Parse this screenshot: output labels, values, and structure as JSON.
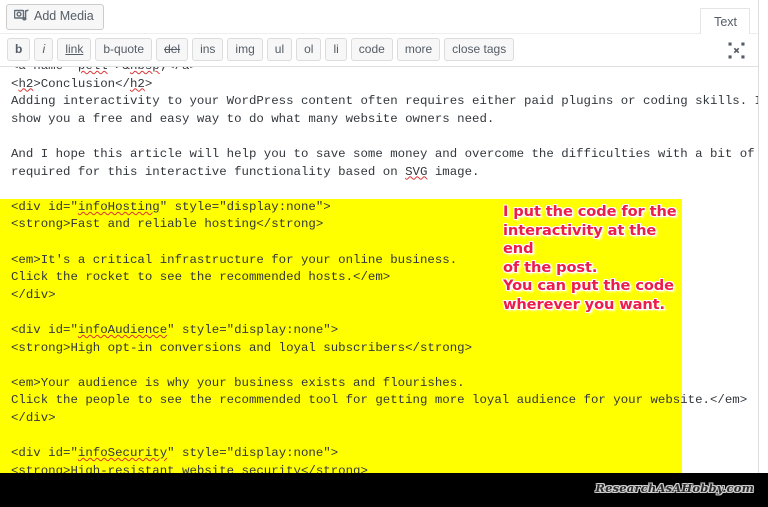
{
  "window": {
    "app": "WordPress Post Editor",
    "editor_mode": "Text"
  },
  "media_row": {
    "add_media_label": "Add Media",
    "add_media_icon": "media-icon"
  },
  "tabs": [
    {
      "label": "Text",
      "active": true
    }
  ],
  "quicktags": {
    "buttons": [
      {
        "label": "b",
        "name": "qt-bold"
      },
      {
        "label": "i",
        "name": "qt-italic"
      },
      {
        "label": "link",
        "name": "qt-link"
      },
      {
        "label": "b-quote",
        "name": "qt-blockquote"
      },
      {
        "label": "del",
        "name": "qt-del"
      },
      {
        "label": "ins",
        "name": "qt-ins"
      },
      {
        "label": "img",
        "name": "qt-img"
      },
      {
        "label": "ul",
        "name": "qt-ul"
      },
      {
        "label": "ol",
        "name": "qt-ol"
      },
      {
        "label": "li",
        "name": "qt-li"
      },
      {
        "label": "code",
        "name": "qt-code"
      },
      {
        "label": "more",
        "name": "qt-more"
      },
      {
        "label": "close tags",
        "name": "qt-close-tags"
      }
    ],
    "fullscreen_icon": "distraction-free-writing-icon"
  },
  "code": {
    "lines": [
      {
        "text": "<a name=\"pell\">&nbsp;</a>",
        "highlight": false
      },
      {
        "text": "<h2>Conclusion</h2>",
        "highlight": false
      },
      {
        "text": "Adding interactivity to your WordPress content often requires either paid plugins or coding skills. I wanted to",
        "highlight": false
      },
      {
        "text": "show you a free and easy way to do what many website owners need.",
        "highlight": false
      },
      {
        "text": "",
        "highlight": false
      },
      {
        "text": "And I hope this article will help you to save some money and overcome the difficulties with a bit of coding that is",
        "highlight": false
      },
      {
        "text": "required for this interactive functionality based on SVG image.",
        "highlight": false
      },
      {
        "text": "",
        "highlight": false
      },
      {
        "text": "<div id=\"infoHosting\" style=\"display:none\">",
        "highlight": true
      },
      {
        "text": "<strong>Fast and reliable hosting</strong>",
        "highlight": true
      },
      {
        "text": "",
        "highlight": true
      },
      {
        "text": "<em>It's a critical infrastructure for your online business.",
        "highlight": true
      },
      {
        "text": "Click the rocket to see the recommended hosts.</em>",
        "highlight": true
      },
      {
        "text": "</div>",
        "highlight": true
      },
      {
        "text": "",
        "highlight": true
      },
      {
        "text": "<div id=\"infoAudience\" style=\"display:none\">",
        "highlight": true
      },
      {
        "text": "<strong>High opt-in conversions and loyal subscribers</strong>",
        "highlight": true
      },
      {
        "text": "",
        "highlight": true
      },
      {
        "text": "<em>Your audience is why your business exists and flourishes.",
        "highlight": true
      },
      {
        "text": "Click the people to see the recommended tool for getting more loyal audience for your website.</em>",
        "highlight": true
      },
      {
        "text": "</div>",
        "highlight": true
      },
      {
        "text": "",
        "highlight": true
      },
      {
        "text": "<div id=\"infoSecurity\" style=\"display:none\">",
        "highlight": true
      },
      {
        "text": "<strong>High-resistant website security</strong>",
        "highlight": true
      }
    ]
  },
  "annotation": {
    "text": "I put the code for the\ninteractivity at the end\nof the post.\nYou can put the code\nwherever you want.",
    "color": "#ee1c4a"
  },
  "watermark": {
    "text": "ResearchAsAHobby.com"
  },
  "colors": {
    "highlight": "#ffff00",
    "bottom_bar": "#000000",
    "code_text": "#32373c",
    "annotation": "#ee1c4a"
  }
}
